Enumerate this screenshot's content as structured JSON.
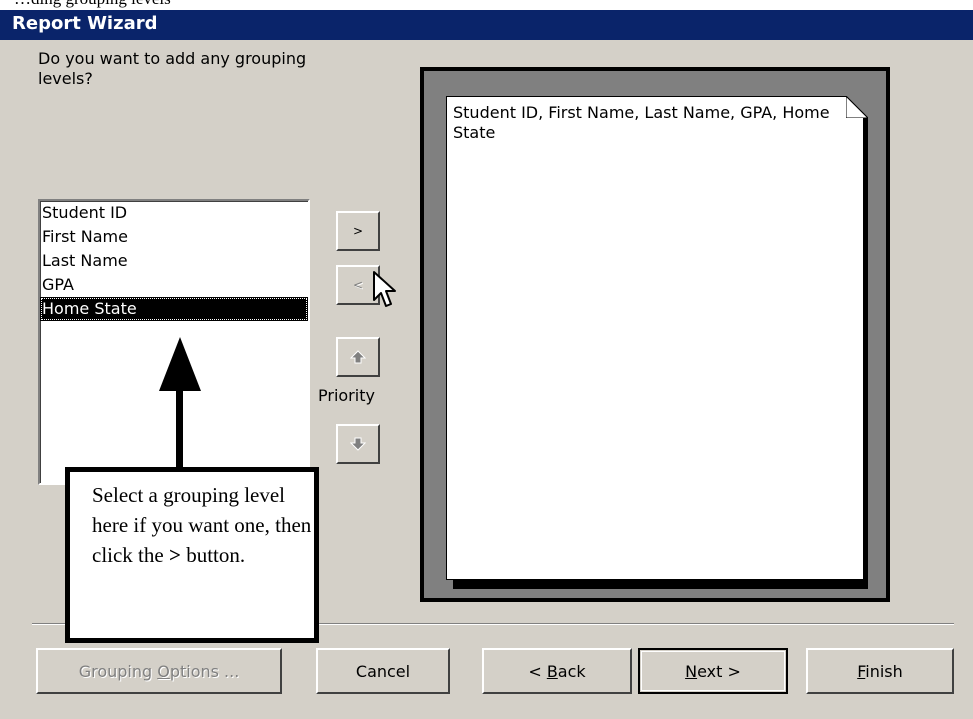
{
  "title": "Report Wizard",
  "question": "Do you want to add any grouping levels?",
  "fields": [
    "Student ID",
    "First Name",
    "Last Name",
    "GPA",
    "Home State"
  ],
  "selected_field": "Home State",
  "buttons": {
    "add": ">",
    "remove": "<",
    "priority_label": "Priority"
  },
  "preview_text": "Student ID, First Name, Last Name, GPA, Home State",
  "callout": {
    "line1": "Select a grouping level here if you want one, then click the ",
    "bold_symbol": ">",
    "line2": " button."
  },
  "footer": {
    "grouping_options_pre": "Grouping ",
    "grouping_options_key": "O",
    "grouping_options_post": "ptions ...",
    "cancel": "Cancel",
    "back_pre": "< ",
    "back_key": "B",
    "back_post": "ack",
    "next_key": "N",
    "next_post": "ext >",
    "finish_key": "F",
    "finish_post": "inish"
  },
  "colors": {
    "titlebar": "#0a246a",
    "dialog": "#d4d0c8"
  }
}
